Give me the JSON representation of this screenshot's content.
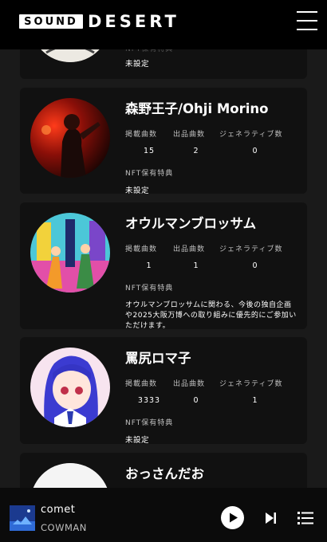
{
  "header": {
    "logo_sound": "SOUND",
    "logo_desert": "DESERT"
  },
  "cards": [
    {
      "name": "",
      "nft_label": "NFT保有特典",
      "nft_value": "未設定"
    },
    {
      "name": "森野王子/Ohji Morino",
      "stats": [
        {
          "label": "掲載曲数",
          "value": "15"
        },
        {
          "label": "出品曲数",
          "value": "2"
        },
        {
          "label": "ジェネラティブ数",
          "value": "0"
        }
      ],
      "nft_label": "NFT保有特典",
      "nft_value": "未設定"
    },
    {
      "name": "オウルマンブロッサム",
      "stats": [
        {
          "label": "掲載曲数",
          "value": "1"
        },
        {
          "label": "出品曲数",
          "value": "1"
        },
        {
          "label": "ジェネラティブ数",
          "value": "0"
        }
      ],
      "nft_label": "NFT保有特典",
      "nft_value": "オウルマンブロッサムに関わる、今後の独自企画や2025大阪万博への取り組みに優先的にご参加いただけます。"
    },
    {
      "name": "罵尻ロマ子",
      "stats": [
        {
          "label": "掲載曲数",
          "value": "3333"
        },
        {
          "label": "出品曲数",
          "value": "0"
        },
        {
          "label": "ジェネラティブ数",
          "value": "1"
        }
      ],
      "nft_label": "NFT保有特典",
      "nft_value": "未設定"
    },
    {
      "name": "おっさんだお"
    }
  ],
  "player": {
    "title": "comet",
    "artist": "COWMAN"
  },
  "icons": [
    "menu-icon",
    "play-icon",
    "skip-next-icon",
    "queue-list-icon"
  ]
}
